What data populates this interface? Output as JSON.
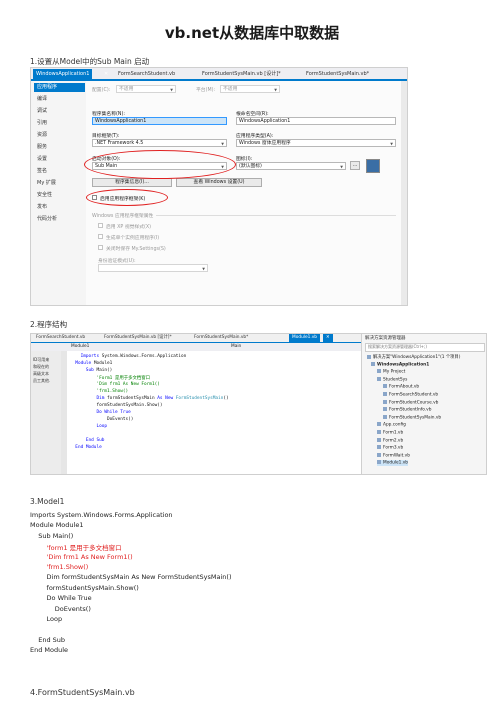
{
  "doc": {
    "title": "vb.net从数据库中取数据",
    "headings": [
      "1.设置从Model中的Sub Main 启动",
      "2.程序结构",
      "3.Model1",
      "4.FormStudentSysMain.vb"
    ]
  },
  "shot1": {
    "tabs": [
      "WindowsApplication1",
      "✕",
      "FormSearchStudent.vb",
      "FormStudentSysMain.vb [设计]*",
      "FormStudentSysMain.vb*"
    ],
    "nav": [
      "应用程序",
      "编译",
      "调试",
      "引用",
      "资源",
      "服务",
      "设置",
      "签名",
      "My 扩展",
      "安全性",
      "发布",
      "代码分析"
    ],
    "top_row": {
      "config_label": "配置(C):",
      "config_value": "不适用",
      "platform_label": "平台(M):",
      "platform_value": "不适用"
    },
    "assembly_label": "程序集名称(N):",
    "assembly_value": "WindowsApplication1",
    "root_ns_label": "根命名空间(R):",
    "root_ns_value": "WindowsApplication1",
    "target_fw_label": "目标框架(T):",
    "target_fw_value": ".NET Framework 4.5",
    "app_type_label": "应用程序类型(A):",
    "app_type_value": "Windows 窗体应用程序",
    "startup_label": "启动对象(O):",
    "startup_value": "Sub Main",
    "icon_label": "图标(I):",
    "icon_value": "(默认图标)",
    "assembly_btn": "程序集信息(I)...",
    "uac_btn": "查看 Windows 设置(U)",
    "app_framework_label": "启用应用程序框架(K)",
    "win_props_label": "Windows 应用程序框架属性",
    "opt1": "启用 XP 视觉样式(X)",
    "opt2": "生成单个实例应用程序(I)",
    "opt3": "关闭时保存 My.Settings(S)",
    "auth_label": "身份验证模式(U):"
  },
  "shot2": {
    "tabs": [
      "FormSearchStudent.vb",
      "FormStudentSysMain.vb [设计]*",
      "FormStudentSysMain.vb*",
      "Module1.vb",
      "✕"
    ],
    "editor_left": "Module1",
    "editor_right": "Main",
    "left_strip": [
      "ID可用来",
      "和现在的",
      "高级文本",
      "员工其他."
    ],
    "code_lines": [
      {
        "indent": "    ",
        "parts": [
          [
            "kw",
            "Imports"
          ],
          [
            "tx",
            " System.Windows.Forms.Application"
          ]
        ]
      },
      {
        "indent": "  ",
        "parts": [
          [
            "kw",
            "Module"
          ],
          [
            "tx",
            " Module1"
          ]
        ]
      },
      {
        "indent": "      ",
        "parts": [
          [
            "kw",
            "Sub"
          ],
          [
            "tx",
            " Main()"
          ]
        ]
      },
      {
        "indent": "          ",
        "parts": [
          [
            "cm",
            "'Form1 是用于多文档窗口"
          ]
        ]
      },
      {
        "indent": "          ",
        "parts": [
          [
            "cm",
            "'Dim frm1 As New Form1()"
          ]
        ]
      },
      {
        "indent": "          ",
        "parts": [
          [
            "cm",
            "'frm1.Show()"
          ]
        ]
      },
      {
        "indent": "          ",
        "parts": [
          [
            "kw",
            "Dim"
          ],
          [
            "tx",
            " formStudentSysMain "
          ],
          [
            "kw",
            "As New"
          ],
          [
            "ty",
            " FormStudentSysMain"
          ],
          [
            "tx",
            "()"
          ]
        ]
      },
      {
        "indent": "          ",
        "parts": [
          [
            "tx",
            "formStudentSysMain.Show()"
          ]
        ]
      },
      {
        "indent": "          ",
        "parts": [
          [
            "kw",
            "Do While"
          ],
          [
            "kw",
            " True"
          ]
        ]
      },
      {
        "indent": "              ",
        "parts": [
          [
            "tx",
            "DoEvents()"
          ]
        ]
      },
      {
        "indent": "          ",
        "parts": [
          [
            "kw",
            "Loop"
          ]
        ]
      },
      {
        "indent": "",
        "parts": [
          [
            "tx",
            " "
          ]
        ]
      },
      {
        "indent": "      ",
        "parts": [
          [
            "kw",
            "End Sub"
          ]
        ]
      },
      {
        "indent": "  ",
        "parts": [
          [
            "kw",
            "End Module"
          ]
        ]
      }
    ],
    "sol_title": "解决方案资源管理器",
    "sol_search": "搜索解决方案资源管理器(Ctrl+;)",
    "sol_items": [
      "解决方案\"WindowsApplication1\"(1 个项目)",
      "WindowsApplication1",
      "My Project",
      "StudentSys",
      "FormAbout.vb",
      "FormSearchStudent.vb",
      "FormStudentCourse.vb",
      "FormStudentInfo.vb",
      "FormStudentSysMain.vb",
      "App.config",
      "Form1.vb",
      "Form2.vb",
      "Form3.vb",
      "FormWait.vb",
      "Module1.vb"
    ]
  },
  "code3": [
    {
      "text": "Imports System.Windows.Forms.Application",
      "red": false
    },
    {
      "text": "Module Module1",
      "red": false
    },
    {
      "text": "    Sub Main()",
      "red": false
    },
    {
      "text": "        'form1 是用于多文档窗口",
      "red": true
    },
    {
      "text": "        'Dim frm1 As New Form1()",
      "red": true
    },
    {
      "text": "        'frm1.Show()",
      "red": true
    },
    {
      "text": "        Dim formStudentSysMain As New FormStudentSysMain()",
      "red": false
    },
    {
      "text": "        formStudentSysMain.Show()",
      "red": false
    },
    {
      "text": "        Do While True",
      "red": false
    },
    {
      "text": "            DoEvents()",
      "red": false
    },
    {
      "text": "        Loop",
      "red": false
    },
    {
      "text": " ",
      "red": false
    },
    {
      "text": "    End Sub",
      "red": false
    },
    {
      "text": "End Module",
      "red": false
    }
  ],
  "colors": {
    "accent": "#007acc",
    "annotation_red": "#e02020",
    "keyword": "#0000ff",
    "comment": "#008000",
    "type": "#2b91af"
  }
}
